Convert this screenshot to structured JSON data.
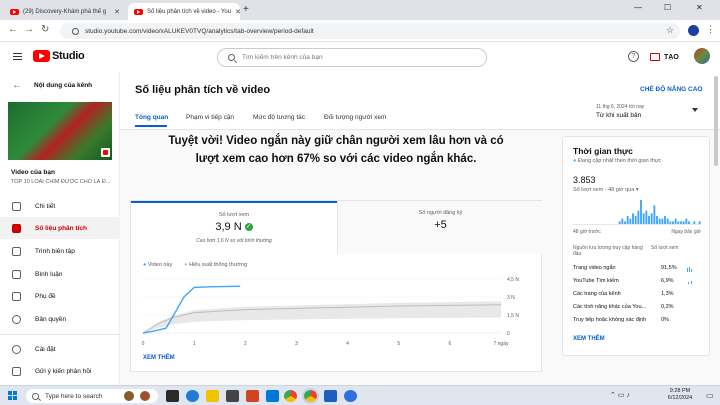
{
  "browser": {
    "tabs": [
      {
        "title": "(29) Discovery-Khám phá thế g",
        "active": false
      },
      {
        "title": "Số liệu phân tích về video - You",
        "active": true
      }
    ],
    "url": "studio.youtube.com/video/xALUKEV0TVQ/analytics/tab-overview/period-default",
    "new_tab": "+",
    "window_controls": [
      "—",
      "☐",
      "✕"
    ]
  },
  "header": {
    "logo_text": "Studio",
    "search_placeholder": "Tìm kiếm trên kênh của bạn",
    "create_label": "TẠO"
  },
  "sidebar": {
    "back_title": "Nội dung của kênh",
    "video_label": "Video của bạn",
    "video_title": "TOP 10 LOÀI CHIM ĐƯỢC CHO LÀ Đ...",
    "items": [
      {
        "label": "Chi tiết",
        "icon": "pencil-icon",
        "active": false
      },
      {
        "label": "Số liệu phân tích",
        "icon": "analytics-icon",
        "active": true
      },
      {
        "label": "Trình biên tập",
        "icon": "editor-icon",
        "active": false
      },
      {
        "label": "Bình luận",
        "icon": "comment-icon",
        "active": false
      },
      {
        "label": "Phụ đề",
        "icon": "subtitles-icon",
        "active": false
      },
      {
        "label": "Bản quyền",
        "icon": "copyright-icon",
        "active": false
      }
    ],
    "bottom_items": [
      {
        "label": "Cài đặt",
        "icon": "gear-icon"
      },
      {
        "label": "Gửi ý kiến phản hồi",
        "icon": "feedback-icon"
      }
    ]
  },
  "main": {
    "title": "Số liệu phân tích về video",
    "advanced_link": "CHẾ ĐỘ NÂNG CAO",
    "tabs": [
      "Tổng quan",
      "Phạm vi tiếp cận",
      "Mức độ tương tác",
      "Đối tượng người xem"
    ],
    "period": {
      "line1": "11 thg 6, 2024 tới nay",
      "line2": "Từ khi xuất bản"
    },
    "headline_line1": "Tuyệt vời! Video ngắn này giữ chân người xem lâu hơn và có",
    "headline_line2": "lượt xem cao hơn 67% so với các video ngắn khác.",
    "metrics": [
      {
        "label": "Số lượt xem",
        "value": "3,9 N",
        "note": "Cao hơn 1,6 N so với bình thường"
      },
      {
        "label": "Số người đăng ký",
        "value": "+5"
      }
    ],
    "legend": {
      "this_video": "Video này",
      "typical": "Hiệu suất thông thường"
    },
    "see_more": "XEM THÊM"
  },
  "chart_data": {
    "type": "line",
    "x_ticks": [
      "0",
      "1",
      "2",
      "3",
      "4",
      "5",
      "6",
      "7 ngày"
    ],
    "y_ticks": [
      "4,5 N",
      "3 N",
      "1,5 N",
      "0"
    ],
    "ylim": [
      0,
      4500
    ],
    "xlim": [
      0,
      7
    ],
    "series": [
      {
        "name": "Video này",
        "x": [
          0,
          0.2,
          0.45,
          0.6,
          0.8,
          1.0,
          1.3,
          1.6,
          1.9
        ],
        "y": [
          0,
          150,
          400,
          1500,
          3000,
          3800,
          3850,
          3870,
          3900
        ]
      },
      {
        "name": "Hiệu suất thông thường",
        "x": [
          0,
          0.3,
          0.6,
          1,
          2,
          3,
          4,
          5,
          6,
          7
        ],
        "y": [
          0,
          800,
          1300,
          1700,
          1950,
          2050,
          2150,
          2250,
          2300,
          2350
        ]
      }
    ],
    "colors": {
      "this_video": "#3ea6ff",
      "typical": "#bdbdbd",
      "band": "#e8e8e8"
    }
  },
  "realtime": {
    "title": "Thời gian thực",
    "subtitle": "Đang cập nhật theo thời gian thực",
    "value": "3.853",
    "value_label": "Số lượt xem · 48 giờ qua",
    "axis_left": "48 giờ trước",
    "axis_right": "Ngay bây giờ",
    "bars": [
      0,
      0,
      0,
      0,
      0,
      0,
      0,
      0,
      0,
      0,
      0,
      0,
      0,
      0,
      0,
      0,
      0,
      1,
      2,
      1,
      3,
      2,
      4,
      3,
      5,
      9,
      4,
      5,
      3,
      4,
      7,
      3,
      2,
      2,
      3,
      2,
      1,
      1,
      2,
      1,
      1,
      1,
      2,
      1,
      0,
      1,
      0,
      1
    ],
    "sources_header": "Nguồn lưu lượng truy cập hàng đầu",
    "sources_col": "Số lượt xem",
    "sources": [
      {
        "name": "Trang video ngắn",
        "pct": "91,5%"
      },
      {
        "name": "YouTube Tìm kiếm",
        "pct": "6,9%"
      },
      {
        "name": "Các trang của kênh",
        "pct": "1,3%"
      },
      {
        "name": "Các tính năng khác của You...",
        "pct": "0,2%"
      },
      {
        "name": "Truy tiếp hoặc không xác định",
        "pct": "0%"
      }
    ],
    "see_more": "XEM THÊM"
  },
  "taskbar": {
    "search_placeholder": "Type here to search",
    "time": "9:28 PM",
    "date": "6/12/2024"
  },
  "colors": {
    "accent": "#065fd4",
    "brand": "#ff0000",
    "active_side": "#cc0000"
  }
}
